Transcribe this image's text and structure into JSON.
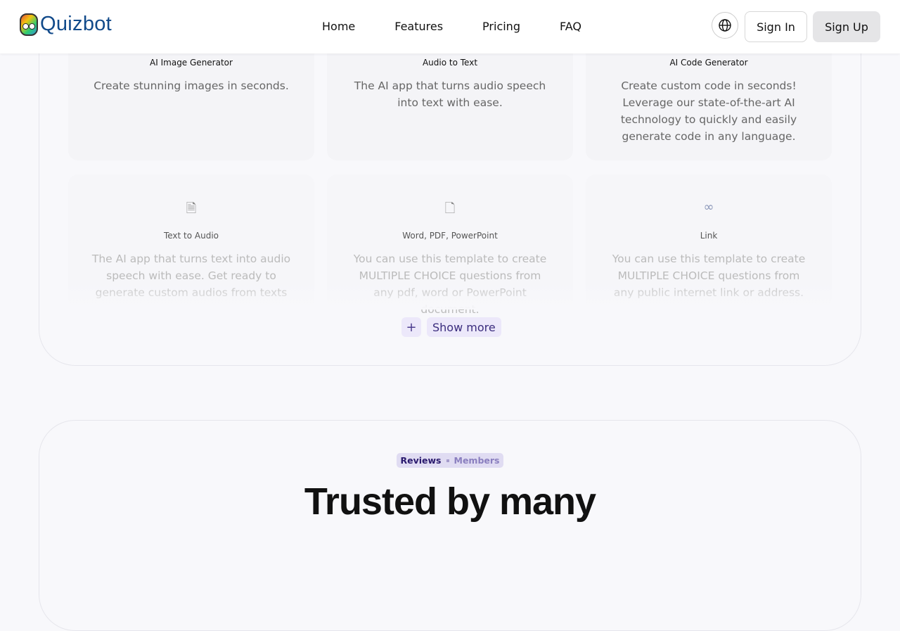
{
  "header": {
    "brand": "Quizbot",
    "nav": [
      "Home",
      "Features",
      "Pricing",
      "FAQ"
    ],
    "sign_in": "Sign In",
    "sign_up": "Sign Up"
  },
  "cards_row1": [
    {
      "title": "AI Image Generator",
      "desc": "Create stunning images in seconds."
    },
    {
      "title": "Audio to Text",
      "desc": "The AI app that turns audio speech into text with ease."
    },
    {
      "title": "AI Code Generator",
      "desc": "Create custom code in seconds! Leverage our state-of-the-art AI technology to quickly and easily generate code in any language."
    }
  ],
  "cards_row2": [
    {
      "icon": "text-audio-icon",
      "title": "Text to Audio",
      "desc": "The AI app that turns text into audio speech with ease. Get ready to generate custom audios from texts"
    },
    {
      "icon": "pdf-icon",
      "title": "Word, PDF, PowerPoint",
      "desc": "You can use this template to create MULTIPLE CHOICE questions from any pdf, word or PowerPoint document."
    },
    {
      "icon": "link-icon",
      "title": "Link",
      "desc": "You can use this template to create MULTIPLE CHOICE questions from any public internet link or address."
    }
  ],
  "show_more": "Show more",
  "reviews": {
    "tab_active": "Reviews",
    "tab_other": "Members",
    "heading": "Trusted by many"
  }
}
